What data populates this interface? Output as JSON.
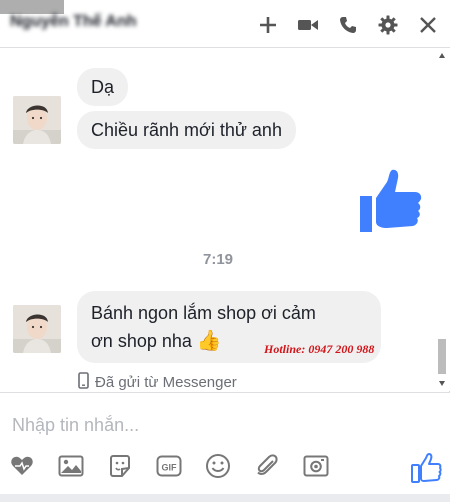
{
  "header": {
    "title": "Nguyễn Thế Anh",
    "icons": [
      "plus-icon",
      "video-call-icon",
      "phone-icon",
      "gear-icon",
      "close-icon"
    ]
  },
  "messages": {
    "bubble_1": "Dạ",
    "bubble_2": "Chiều rãnh mới thử anh",
    "sent_sticker": "thumbs-up-icon",
    "time": "7:19",
    "bubble_3_line1": "Bánh ngon lắm shop ơi cảm",
    "bubble_3_line2": "ơn shop nha",
    "bubble_3_emoji": "👍",
    "watermark": "Hotline: 0947 200 988",
    "sent_status": "Đã gửi từ Messenger"
  },
  "composer": {
    "placeholder": "Nhập tin nhắn...",
    "tools": [
      "heart-icon",
      "photo-icon",
      "sticker-icon",
      "gif-icon",
      "emoji-icon",
      "attachment-icon",
      "camera-icon"
    ],
    "like_icon": "thumbs-up-icon"
  },
  "colors": {
    "accent": "#4080ff",
    "bubble_bg": "#f1f0f0",
    "hotline": "#d0161b",
    "icon_grey": "#777777"
  }
}
